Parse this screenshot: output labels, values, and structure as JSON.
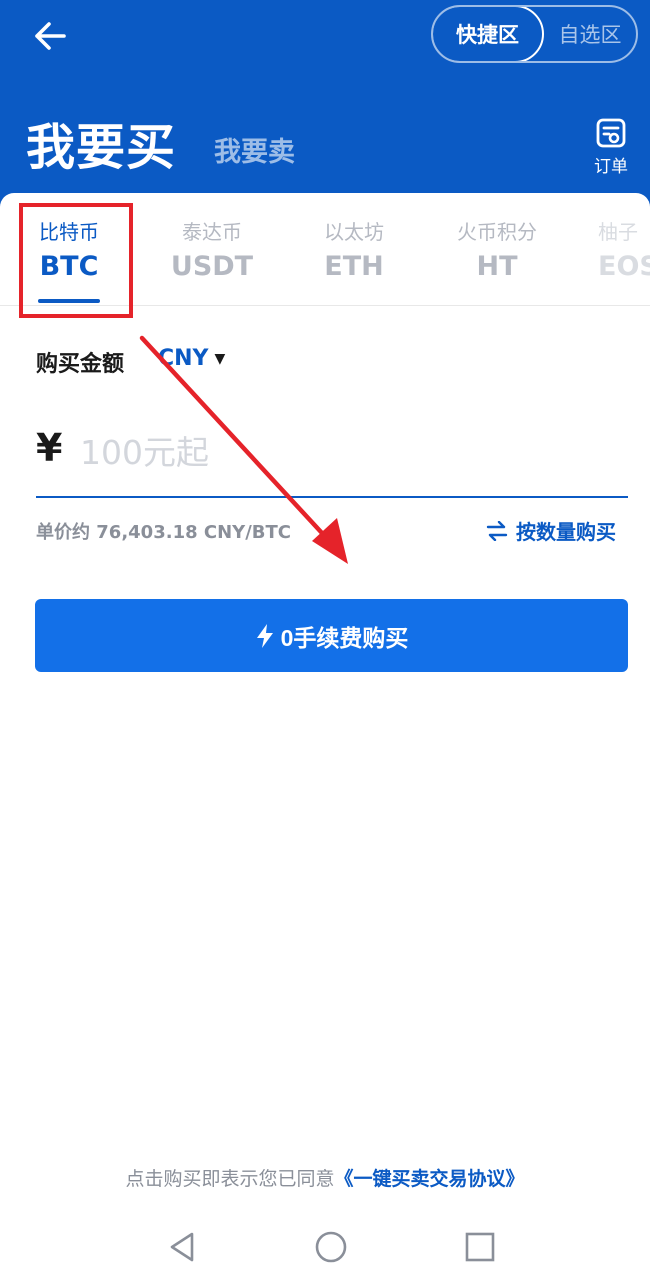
{
  "header": {
    "zone_active": "快捷区",
    "zone_inactive": "自选区",
    "title_buy": "我要买",
    "title_sell": "我要卖",
    "orders_label": "订单",
    "bg_color": "#0b5ac4"
  },
  "coins": [
    {
      "cn": "比特币",
      "symbol": "BTC",
      "active": true
    },
    {
      "cn": "泰达币",
      "symbol": "USDT",
      "active": false
    },
    {
      "cn": "以太坊",
      "symbol": "ETH",
      "active": false
    },
    {
      "cn": "火币积分",
      "symbol": "HT",
      "active": false
    },
    {
      "cn": "柚子",
      "symbol": "EOS",
      "active": false
    }
  ],
  "amount": {
    "label": "购买金额",
    "currency": "CNY",
    "currency_symbol": "¥",
    "placeholder": "100元起",
    "value": ""
  },
  "unit_price": "单价约 76,403.18 CNY/BTC",
  "buy_by_quantity": "按数量购买",
  "buy_button": "0手续费购买",
  "agreement": {
    "prefix": "点击购买即表示您已同意",
    "link": "《一键买卖交易协议》"
  },
  "colors": {
    "accent": "#0b5ac4",
    "button": "#1370e8",
    "annotation": "#e5232a"
  }
}
